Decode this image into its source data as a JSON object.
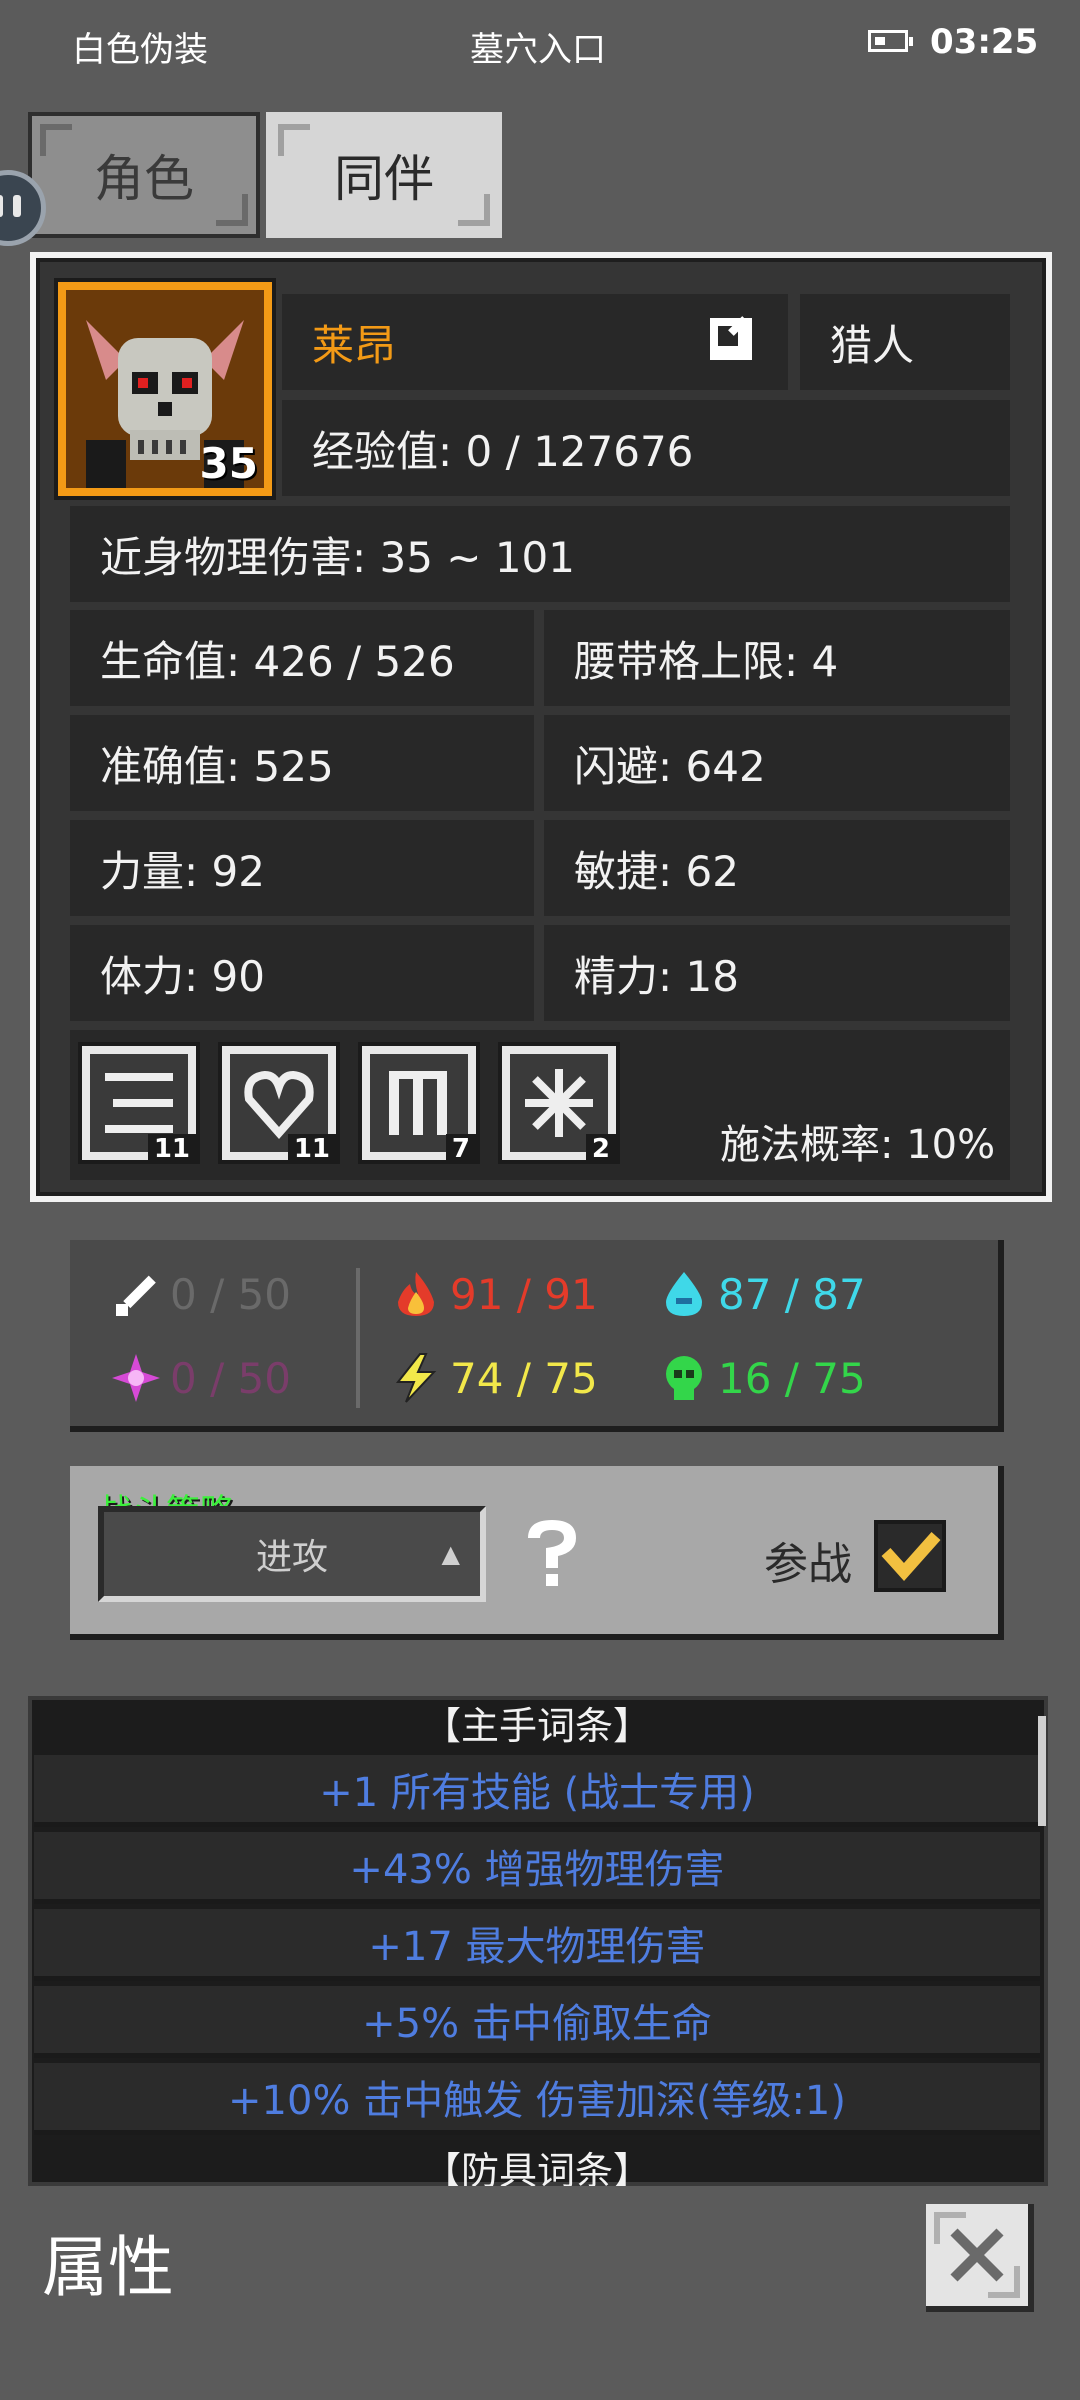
{
  "status_bar": {
    "left": "白色伪装",
    "center": "墓穴入口",
    "time": "03:25"
  },
  "tabs": [
    {
      "label": "角色"
    },
    {
      "label": "同伴"
    }
  ],
  "companion": {
    "level": "35",
    "name": "莱昂",
    "class": "猎人",
    "exp": "经验值: 0 / 127676",
    "damage": "近身物理伤害: 35 ~ 101",
    "stats": [
      "生命值: 426 / 526",
      "腰带格上限: 4",
      "准确值: 525",
      "闪避: 642",
      "力量: 92",
      "敏捷: 62",
      "体力: 90",
      "精力: 18"
    ],
    "skills": [
      {
        "icon": "lines-skill-icon",
        "count": "11"
      },
      {
        "icon": "heart-skill-icon",
        "count": "11"
      },
      {
        "icon": "pillar-skill-icon",
        "count": "7"
      },
      {
        "icon": "star-skill-icon",
        "count": "2"
      }
    ],
    "cast_rate": "施法概率: 10%"
  },
  "resistances": [
    {
      "name": "physical",
      "value": "0 / 50",
      "color": "#6a6a6a"
    },
    {
      "name": "fire",
      "value": "91 / 91",
      "color": "#e43b2a"
    },
    {
      "name": "cold",
      "value": "87 / 87",
      "color": "#3fd8e8"
    },
    {
      "name": "magic",
      "value": "0 / 50",
      "color": "#7a3d6a"
    },
    {
      "name": "lightning",
      "value": "74 / 75",
      "color": "#f2e84a"
    },
    {
      "name": "poison",
      "value": "16 / 75",
      "color": "#33d64a"
    }
  ],
  "strategy": {
    "label": "战斗策略",
    "value": "进攻",
    "join_label": "参战"
  },
  "affixes": {
    "main_header": "【主手词条】",
    "items": [
      "+1 所有技能 (战士专用)",
      "+43% 增强物理伤害",
      "+17 最大物理伤害",
      "+5% 击中偷取生命",
      "+10% 击中触发 伤害加深(等级:1)"
    ],
    "armor_header": "【防具词条】"
  },
  "footer": {
    "title": "属性"
  }
}
